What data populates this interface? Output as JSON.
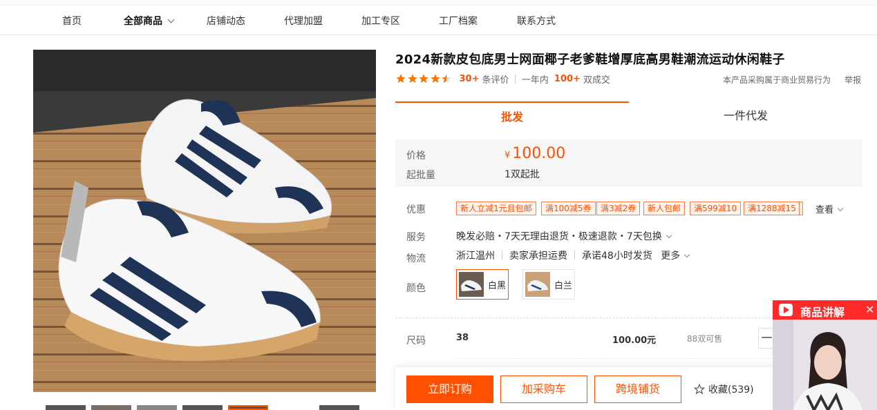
{
  "nav": {
    "items": [
      "首页",
      "全部商品",
      "店铺动态",
      "代理加盟",
      "加工专区",
      "工厂档案",
      "联系方式"
    ]
  },
  "product": {
    "title": "2024新款皮包底男士网面椰子老爹鞋增厚底高男鞋潮流运动休闲鞋子",
    "rating_stars": 4.5,
    "reviews_count": "30+",
    "reviews_label": "条评价",
    "period_label": "一年内",
    "deals_count": "100+",
    "deals_label": "双成交",
    "trade_note": "本产品采购属于商业贸易行为",
    "report": "举报"
  },
  "tabs": {
    "wholesale": "批发",
    "dropship": "一件代发"
  },
  "pricing": {
    "price_label": "价格",
    "currency": "¥",
    "price": "100.00",
    "moq_label": "起批量",
    "moq": "1双起批"
  },
  "promo": {
    "label": "优惠",
    "coupons": [
      "新人立减1元且包邮",
      "满100减5券",
      "满3减2券",
      "新人包邮",
      "满599减10",
      "满1288减15"
    ],
    "view_more": "查看"
  },
  "service": {
    "label": "服务",
    "text": "晚发必赔・7天无理由退货・极速退款・7天包换"
  },
  "logistics": {
    "label": "物流",
    "origin": "浙江温州",
    "freight": "卖家承担运费",
    "promise": "承诺48小时发货",
    "more": "更多"
  },
  "colors": {
    "label": "颜色",
    "options": [
      "白黑",
      "白兰"
    ]
  },
  "size": {
    "label": "尺码",
    "value": "38",
    "price": "100.00元",
    "stock": "88双可售",
    "minus": "一"
  },
  "actions": {
    "buy": "立即订购",
    "cart": "加采购车",
    "cross": "跨境铺货",
    "favorite": "收藏(539)"
  },
  "live": {
    "title": "商品讲解",
    "close": "✕"
  },
  "colors_theme": {
    "accent": "#ff5000",
    "live_red": "#ff2a2a",
    "star": "#ff7300"
  }
}
